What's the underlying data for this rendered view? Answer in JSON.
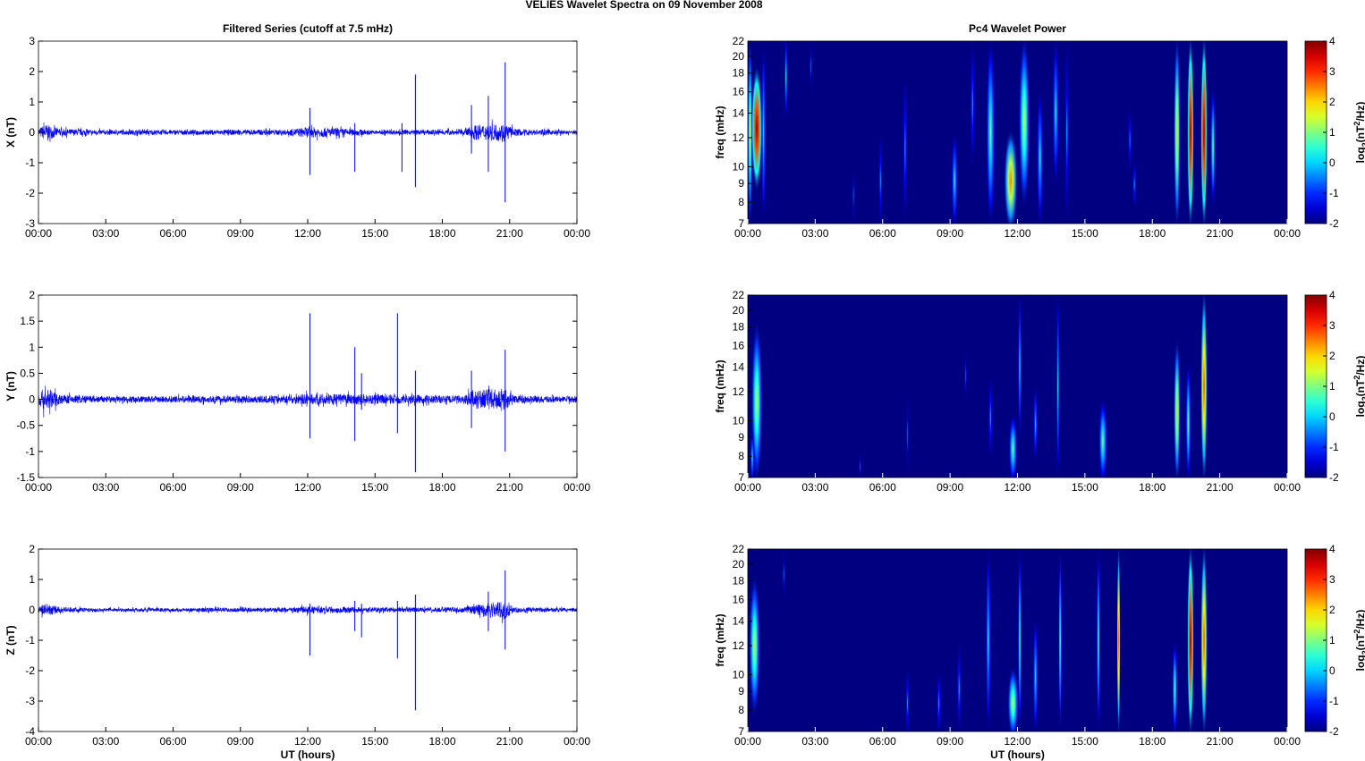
{
  "title": "VELIES Wavelet Spectra on 09 November  2008",
  "chart_data": [
    {
      "type": "line",
      "title": "Filtered Series (cutoff at 7.5 mHz)",
      "ylabel": "X (nT)",
      "xlabel": "",
      "xlim": [
        0,
        24
      ],
      "ylim": [
        -3,
        3
      ],
      "xticks": [
        "00:00",
        "03:00",
        "06:00",
        "09:00",
        "12:00",
        "15:00",
        "18:00",
        "21:00",
        "00:00"
      ],
      "yticks": [
        -3,
        -2,
        -1,
        0,
        1,
        2,
        3
      ],
      "color": "#0000ff",
      "noise_envelope": [
        [
          0,
          0.2
        ],
        [
          0.3,
          0.45
        ],
        [
          1,
          0.2
        ],
        [
          3,
          0.13
        ],
        [
          11,
          0.15
        ],
        [
          12,
          0.3
        ],
        [
          13,
          0.25
        ],
        [
          15,
          0.12
        ],
        [
          19,
          0.15
        ],
        [
          19.3,
          0.4
        ],
        [
          20,
          0.45
        ],
        [
          20.8,
          0.5
        ],
        [
          21.2,
          0.2
        ],
        [
          24,
          0.1
        ]
      ],
      "spikes": [
        {
          "t": 12.1,
          "max": 0.8,
          "min": -1.4
        },
        {
          "t": 14.1,
          "max": 0.3,
          "min": -1.3
        },
        {
          "t": 16.2,
          "max": 0.3,
          "min": -1.3
        },
        {
          "t": 16.8,
          "max": 1.9,
          "min": -1.8
        },
        {
          "t": 19.3,
          "max": 0.9,
          "min": -0.7
        },
        {
          "t": 20.05,
          "max": 1.2,
          "min": -1.3
        },
        {
          "t": 20.8,
          "max": 2.3,
          "min": -2.3
        }
      ]
    },
    {
      "type": "line",
      "title": "",
      "ylabel": "Y (nT)",
      "xlabel": "",
      "xlim": [
        0,
        24
      ],
      "ylim": [
        -1.5,
        2
      ],
      "xticks": [
        "00:00",
        "03:00",
        "06:00",
        "09:00",
        "12:00",
        "15:00",
        "18:00",
        "21:00",
        "00:00"
      ],
      "yticks": [
        -1.5,
        -1,
        -0.5,
        0,
        0.5,
        1,
        1.5,
        2
      ],
      "color": "#0000ff",
      "noise_envelope": [
        [
          0,
          0.2
        ],
        [
          0.3,
          0.4
        ],
        [
          1,
          0.15
        ],
        [
          3,
          0.1
        ],
        [
          11,
          0.12
        ],
        [
          12,
          0.18
        ],
        [
          16,
          0.15
        ],
        [
          19,
          0.12
        ],
        [
          19.3,
          0.3
        ],
        [
          20.8,
          0.35
        ],
        [
          21.2,
          0.12
        ],
        [
          24,
          0.1
        ]
      ],
      "spikes": [
        {
          "t": 12.1,
          "max": 1.65,
          "min": -0.75
        },
        {
          "t": 14.1,
          "max": 1.0,
          "min": -0.8
        },
        {
          "t": 14.4,
          "max": 0.5,
          "min": -0.2
        },
        {
          "t": 16.0,
          "max": 1.65,
          "min": -0.65
        },
        {
          "t": 16.8,
          "max": 0.55,
          "min": -1.4
        },
        {
          "t": 19.3,
          "max": 0.55,
          "min": -0.55
        },
        {
          "t": 20.8,
          "max": 0.95,
          "min": -1.0
        }
      ]
    },
    {
      "type": "line",
      "title": "",
      "ylabel": "Z (nT)",
      "xlabel": "UT (hours)",
      "xlim": [
        0,
        24
      ],
      "ylim": [
        -4,
        2
      ],
      "xticks": [
        "00:00",
        "03:00",
        "06:00",
        "09:00",
        "12:00",
        "15:00",
        "18:00",
        "21:00",
        "00:00"
      ],
      "yticks": [
        -4,
        -3,
        -2,
        -1,
        0,
        1,
        2
      ],
      "color": "#0000ff",
      "noise_envelope": [
        [
          0,
          0.15
        ],
        [
          0.3,
          0.35
        ],
        [
          1,
          0.15
        ],
        [
          3,
          0.1
        ],
        [
          11,
          0.12
        ],
        [
          12,
          0.2
        ],
        [
          16,
          0.12
        ],
        [
          19,
          0.15
        ],
        [
          20,
          0.4
        ],
        [
          20.8,
          0.5
        ],
        [
          21.2,
          0.15
        ],
        [
          24,
          0.1
        ]
      ],
      "spikes": [
        {
          "t": 12.1,
          "max": 0.2,
          "min": -1.5
        },
        {
          "t": 14.1,
          "max": 0.3,
          "min": -0.7
        },
        {
          "t": 14.4,
          "max": 0.2,
          "min": -0.9
        },
        {
          "t": 16.0,
          "max": 0.3,
          "min": -1.6
        },
        {
          "t": 16.8,
          "max": 0.5,
          "min": -3.3
        },
        {
          "t": 20.05,
          "max": 0.6,
          "min": -0.7
        },
        {
          "t": 20.8,
          "max": 1.3,
          "min": -1.3
        }
      ]
    },
    {
      "type": "heatmap",
      "title": "Pc4 Wavelet Power",
      "ylabel": "freq (mHz)",
      "xlabel": "",
      "xlim": [
        0,
        24
      ],
      "ylim": [
        7,
        22
      ],
      "yscale": "log",
      "xticks": [
        "00:00",
        "03:00",
        "06:00",
        "09:00",
        "12:00",
        "15:00",
        "18:00",
        "21:00",
        "00:00"
      ],
      "yticks": [
        7,
        8,
        9,
        10,
        12,
        14,
        16,
        18,
        20,
        22
      ],
      "colorbar": {
        "label": [
          "log",
          "2",
          "(nT",
          "2",
          "/Hz)"
        ],
        "range": [
          -2,
          4
        ],
        "ticks": [
          -2,
          -1,
          0,
          1,
          2,
          3,
          4
        ]
      },
      "events": [
        {
          "t": 0.1,
          "f": [
            7,
            22
          ],
          "p": 1.5,
          "w": 0.12
        },
        {
          "t": 0.4,
          "f": [
            9,
            18
          ],
          "p": 4,
          "w": 0.25
        },
        {
          "t": 0.7,
          "f": [
            7,
            22
          ],
          "p": 0.5,
          "w": 0.1
        },
        {
          "t": 1.7,
          "f": [
            14,
            22
          ],
          "p": 0.5,
          "w": 0.08
        },
        {
          "t": 2.8,
          "f": [
            16,
            22
          ],
          "p": -0.5,
          "w": 0.06
        },
        {
          "t": 4.7,
          "f": [
            7,
            10
          ],
          "p": -0.5,
          "w": 0.08
        },
        {
          "t": 5.9,
          "f": [
            7,
            12
          ],
          "p": 0,
          "w": 0.08
        },
        {
          "t": 7.0,
          "f": [
            7,
            18
          ],
          "p": 0,
          "w": 0.1
        },
        {
          "t": 9.2,
          "f": [
            7,
            12
          ],
          "p": 0.5,
          "w": 0.15
        },
        {
          "t": 10.0,
          "f": [
            10,
            22
          ],
          "p": 0,
          "w": 0.1
        },
        {
          "t": 10.8,
          "f": [
            7,
            22
          ],
          "p": 1,
          "w": 0.2
        },
        {
          "t": 11.7,
          "f": [
            7,
            12
          ],
          "p": 2.5,
          "w": 0.3
        },
        {
          "t": 12.3,
          "f": [
            8,
            22
          ],
          "p": 1.5,
          "w": 0.25
        },
        {
          "t": 13.0,
          "f": [
            7,
            16
          ],
          "p": 0.5,
          "w": 0.15
        },
        {
          "t": 13.7,
          "f": [
            9,
            22
          ],
          "p": 0.5,
          "w": 0.15
        },
        {
          "t": 14.2,
          "f": [
            7,
            22
          ],
          "p": 0,
          "w": 0.1
        },
        {
          "t": 17.0,
          "f": [
            10,
            14
          ],
          "p": 0,
          "w": 0.08
        },
        {
          "t": 17.2,
          "f": [
            8,
            10
          ],
          "p": 0,
          "w": 0.08
        },
        {
          "t": 19.1,
          "f": [
            7,
            22
          ],
          "p": 2,
          "w": 0.15
        },
        {
          "t": 19.7,
          "f": [
            7,
            22
          ],
          "p": 4,
          "w": 0.15
        },
        {
          "t": 20.3,
          "f": [
            7,
            22
          ],
          "p": 4,
          "w": 0.15
        },
        {
          "t": 20.7,
          "f": [
            8,
            16
          ],
          "p": 1,
          "w": 0.12
        }
      ]
    },
    {
      "type": "heatmap",
      "title": "",
      "ylabel": "freq (mHz)",
      "xlabel": "",
      "xlim": [
        0,
        24
      ],
      "ylim": [
        7,
        22
      ],
      "yscale": "log",
      "xticks": [
        "00:00",
        "03:00",
        "06:00",
        "09:00",
        "12:00",
        "15:00",
        "18:00",
        "21:00",
        "00:00"
      ],
      "yticks": [
        7,
        8,
        9,
        10,
        12,
        14,
        16,
        18,
        20,
        22
      ],
      "colorbar": {
        "label": [
          "log",
          "2",
          "(nT",
          "2",
          "/Hz)"
        ],
        "range": [
          -2,
          4
        ],
        "ticks": [
          -2,
          -1,
          0,
          1,
          2,
          3,
          4
        ]
      },
      "events": [
        {
          "t": 0.4,
          "f": [
            7,
            18
          ],
          "p": 1.5,
          "w": 0.25
        },
        {
          "t": 0.2,
          "f": [
            7,
            9
          ],
          "p": 0.5,
          "w": 0.1
        },
        {
          "t": 5.0,
          "f": [
            7,
            8
          ],
          "p": -0.5,
          "w": 0.06
        },
        {
          "t": 7.1,
          "f": [
            7,
            12
          ],
          "p": -0.5,
          "w": 0.06
        },
        {
          "t": 9.7,
          "f": [
            11,
            16
          ],
          "p": -0.5,
          "w": 0.06
        },
        {
          "t": 10.8,
          "f": [
            8,
            13
          ],
          "p": 0,
          "w": 0.1
        },
        {
          "t": 11.8,
          "f": [
            7,
            10
          ],
          "p": 1,
          "w": 0.2
        },
        {
          "t": 12.1,
          "f": [
            9,
            22
          ],
          "p": 0.5,
          "w": 0.05
        },
        {
          "t": 12.8,
          "f": [
            8,
            12
          ],
          "p": 0.3,
          "w": 0.1
        },
        {
          "t": 13.8,
          "f": [
            7,
            22
          ],
          "p": 0.5,
          "w": 0.08
        },
        {
          "t": 15.8,
          "f": [
            7,
            11
          ],
          "p": 1,
          "w": 0.2
        },
        {
          "t": 19.1,
          "f": [
            7,
            16
          ],
          "p": 2,
          "w": 0.15
        },
        {
          "t": 19.6,
          "f": [
            7,
            14
          ],
          "p": 1,
          "w": 0.12
        },
        {
          "t": 20.3,
          "f": [
            7,
            22
          ],
          "p": 3,
          "w": 0.15
        }
      ]
    },
    {
      "type": "heatmap",
      "title": "",
      "ylabel": "freq (mHz)",
      "xlabel": "UT (hours)",
      "xlim": [
        0,
        24
      ],
      "ylim": [
        7,
        22
      ],
      "yscale": "log",
      "xticks": [
        "00:00",
        "03:00",
        "06:00",
        "09:00",
        "12:00",
        "15:00",
        "18:00",
        "21:00",
        "00:00"
      ],
      "yticks": [
        7,
        8,
        9,
        10,
        12,
        14,
        16,
        18,
        20,
        22
      ],
      "colorbar": {
        "label": [
          "log",
          "2",
          "(nT",
          "2",
          "/Hz)"
        ],
        "range": [
          -2,
          4
        ],
        "ticks": [
          -2,
          -1,
          0,
          1,
          2,
          3,
          4
        ]
      },
      "events": [
        {
          "t": 0.3,
          "f": [
            8,
            18
          ],
          "p": 1.5,
          "w": 0.25
        },
        {
          "t": 1.6,
          "f": [
            16,
            22
          ],
          "p": -0.5,
          "w": 0.06
        },
        {
          "t": 7.1,
          "f": [
            7,
            10
          ],
          "p": 0,
          "w": 0.08
        },
        {
          "t": 8.5,
          "f": [
            7,
            10
          ],
          "p": 0,
          "w": 0.1
        },
        {
          "t": 9.4,
          "f": [
            7,
            12
          ],
          "p": 0,
          "w": 0.1
        },
        {
          "t": 10.7,
          "f": [
            7,
            22
          ],
          "p": 0.5,
          "w": 0.12
        },
        {
          "t": 11.8,
          "f": [
            7,
            10
          ],
          "p": 1.5,
          "w": 0.25
        },
        {
          "t": 12.1,
          "f": [
            7,
            22
          ],
          "p": 1,
          "w": 0.05
        },
        {
          "t": 12.8,
          "f": [
            7,
            14
          ],
          "p": 0.5,
          "w": 0.12
        },
        {
          "t": 13.9,
          "f": [
            7,
            22
          ],
          "p": 1,
          "w": 0.08
        },
        {
          "t": 15.6,
          "f": [
            7,
            22
          ],
          "p": 1,
          "w": 0.05
        },
        {
          "t": 16.5,
          "f": [
            7,
            22
          ],
          "p": 3,
          "w": 0.05
        },
        {
          "t": 19.0,
          "f": [
            7,
            12
          ],
          "p": 1,
          "w": 0.12
        },
        {
          "t": 19.7,
          "f": [
            7,
            22
          ],
          "p": 4,
          "w": 0.15
        },
        {
          "t": 20.3,
          "f": [
            7,
            22
          ],
          "p": 3,
          "w": 0.15
        }
      ]
    }
  ]
}
